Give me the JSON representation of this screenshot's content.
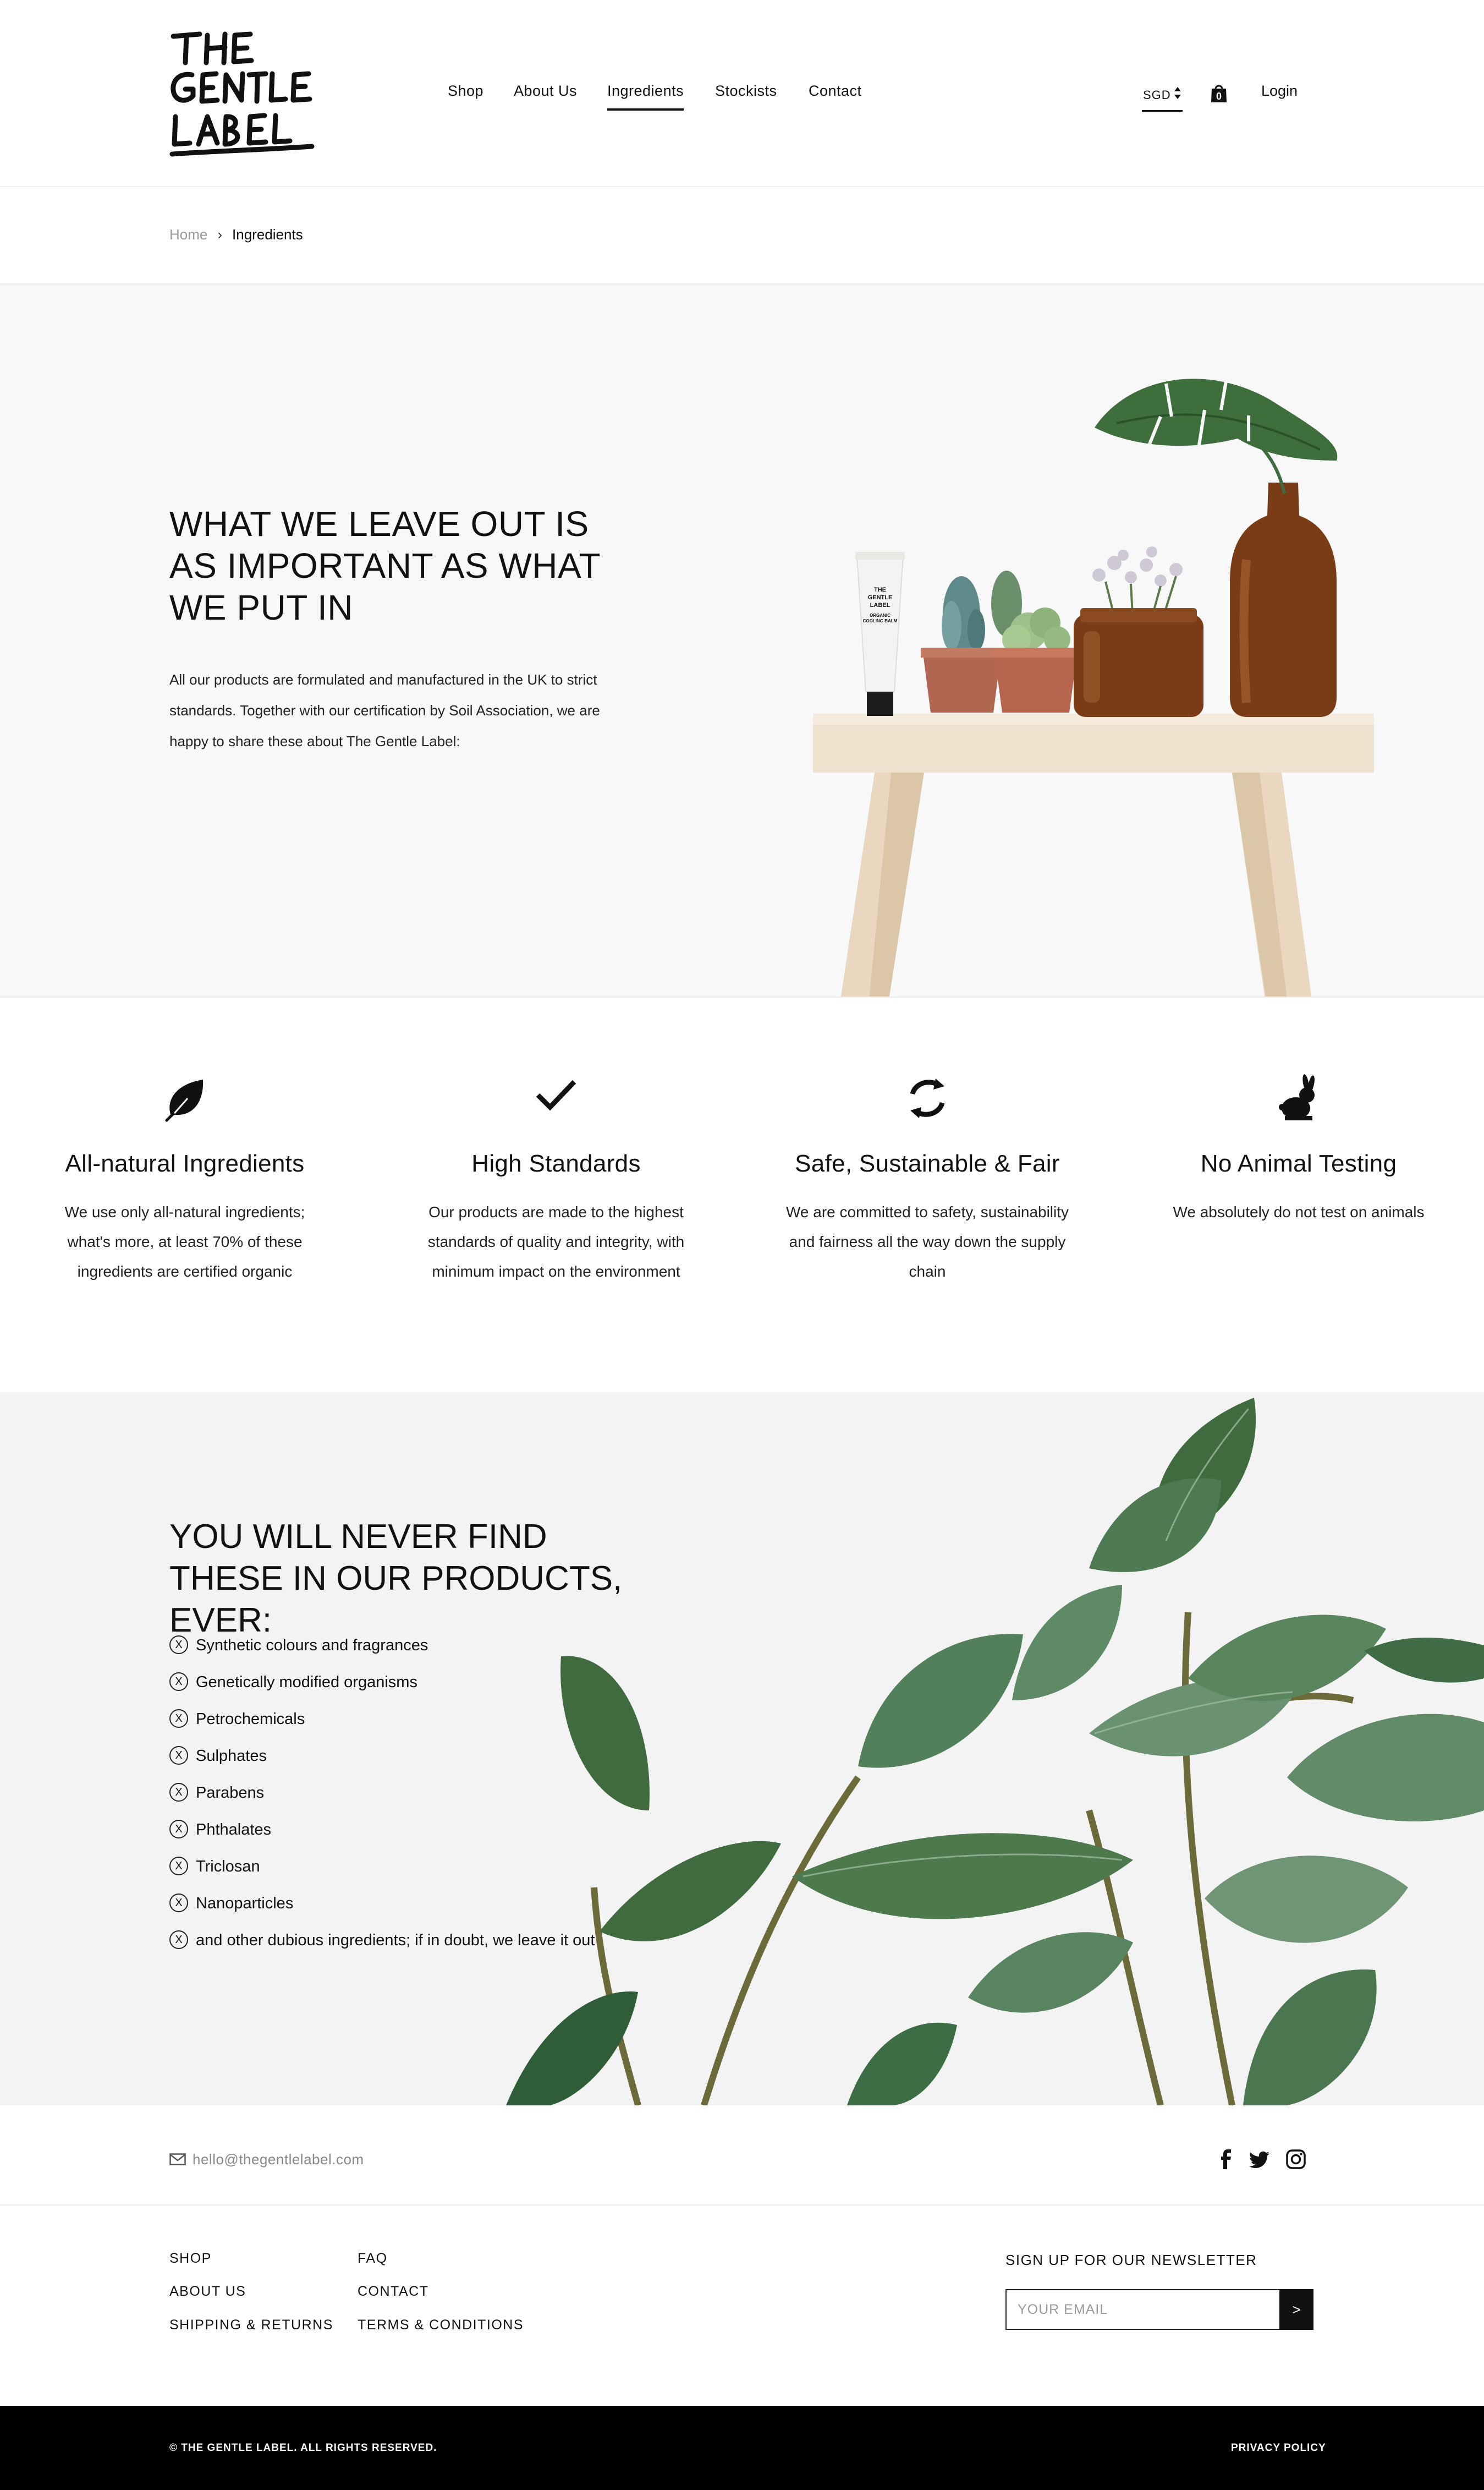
{
  "header": {
    "logo_text": "THE GENTLE LABEL",
    "nav": [
      "Shop",
      "About Us",
      "Ingredients",
      "Stockists",
      "Contact"
    ],
    "active_nav": "Ingredients",
    "currency": "SGD",
    "cart_count": "0",
    "login": "Login"
  },
  "breadcrumb": {
    "home": "Home",
    "separator": "›",
    "current": "Ingredients"
  },
  "hero": {
    "title": "WHAT WE LEAVE OUT IS AS IMPORTANT AS WHAT WE PUT IN",
    "body": "All our products are formulated and manufactured in the UK to strict standards. Together with our certification by Soil Association, we are happy to share these about The Gentle Label:",
    "product_label": "THE GENTLE LABEL ORGANIC COOLING BALM"
  },
  "features": [
    {
      "icon": "leaf-icon",
      "title": "All-natural Ingredients",
      "text": "We use only all-natural ingredients; what's more, at least 70% of these ingredients are certified organic"
    },
    {
      "icon": "checkmark-icon",
      "title": "High Standards",
      "text": "Our products are made to the highest standards of quality and integrity, with minimum impact on the environment"
    },
    {
      "icon": "refresh-icon",
      "title": "Safe, Sustainable & Fair",
      "text": "We are committed to safety, sustainability and fairness all the way down the supply chain"
    },
    {
      "icon": "rabbit-icon",
      "title": "No Animal Testing",
      "text": "We absolutely do not test on animals"
    }
  ],
  "never": {
    "title": "YOU WILL NEVER FIND THESE IN OUR PRODUCTS, EVER:",
    "marker": "X",
    "items": [
      "Synthetic colours and fragrances",
      "Genetically modified organisms",
      "Petrochemicals",
      "Sulphates",
      "Parabens",
      "Phthalates",
      "Triclosan",
      "Nanoparticles",
      "and other dubious ingredients; if in doubt, we leave it out"
    ]
  },
  "contact": {
    "email": "hello@thegentlelabel.com",
    "social": [
      "facebook-icon",
      "twitter-icon",
      "instagram-icon"
    ]
  },
  "footer": {
    "col1": [
      "SHOP",
      "ABOUT US",
      "SHIPPING & RETURNS"
    ],
    "col2": [
      "FAQ",
      "CONTACT",
      "TERMS & CONDITIONS"
    ],
    "newsletter_title": "SIGN UP FOR OUR NEWSLETTER",
    "email_placeholder": "YOUR EMAIL",
    "submit": ">",
    "copyright": "© THE GENTLE LABEL. ALL RIGHTS RESERVED.",
    "privacy": "PRIVACY POLICY"
  },
  "colors": {
    "text": "#111111",
    "hero_bg": "#f8f8f9",
    "never_bg": "#f4f3f4",
    "footer_bg": "#000000",
    "leaf_green": "#3f6b3f",
    "amber_glass": "#7a3c16",
    "terracotta": "#b8654f"
  }
}
